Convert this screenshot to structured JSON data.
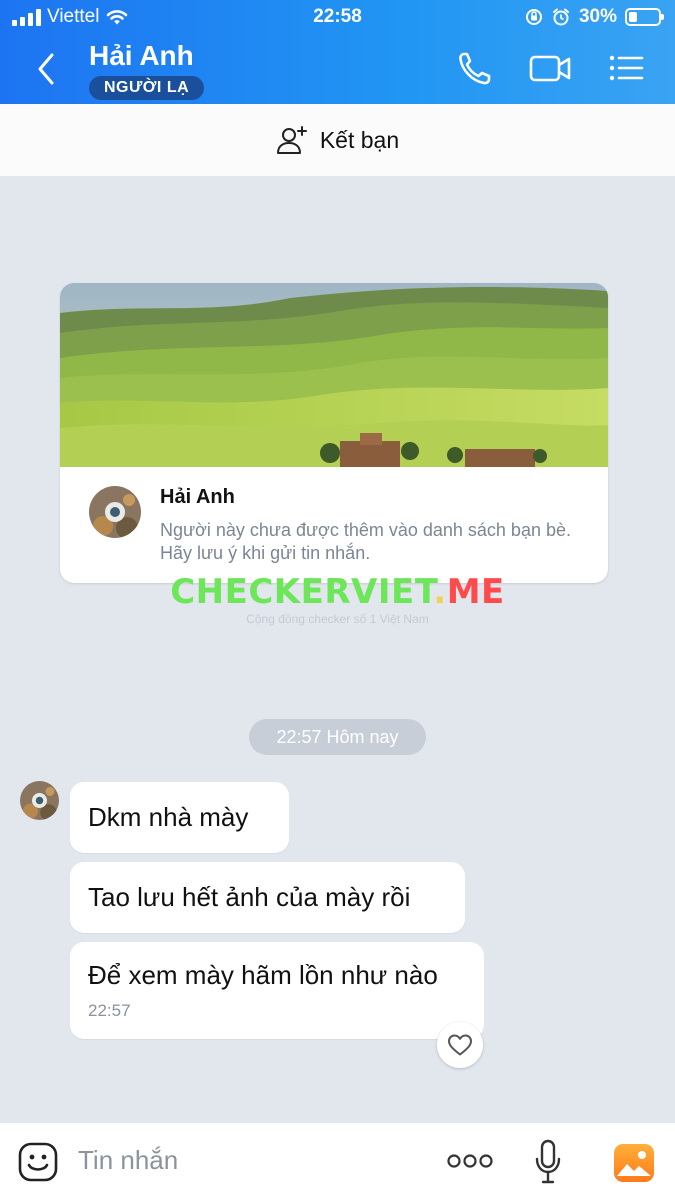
{
  "status_bar": {
    "carrier": "Viettel",
    "time": "22:58",
    "battery": "30%"
  },
  "header": {
    "contact_name": "Hải Anh",
    "badge": "NGƯỜI LẠ"
  },
  "add_friend": {
    "label": "Kết bạn"
  },
  "profile_card": {
    "name": "Hải Anh",
    "description": "Người này chưa được thêm vào danh sách bạn bè. Hãy lưu ý khi gửi tin nhắn."
  },
  "watermark": {
    "main_green": "CHECKERVIET",
    "main_dot": ".",
    "main_red": "ME",
    "sub": "Cộng đồng checker số 1 Việt Nam"
  },
  "conversation": {
    "time_divider": "22:57 Hôm nay",
    "messages": [
      {
        "text": "Dkm nhà mày"
      },
      {
        "text": "Tao lưu hết ảnh của mày rồi"
      },
      {
        "text": "Để xem mày hãm lồn như nào",
        "time": "22:57"
      }
    ]
  },
  "composer": {
    "placeholder": "Tin nhắn"
  },
  "colors": {
    "header_start": "#1d74f2",
    "header_end": "#3aa3f3",
    "watermark_green": "#6ee65a",
    "watermark_red": "#ff4b4b"
  }
}
